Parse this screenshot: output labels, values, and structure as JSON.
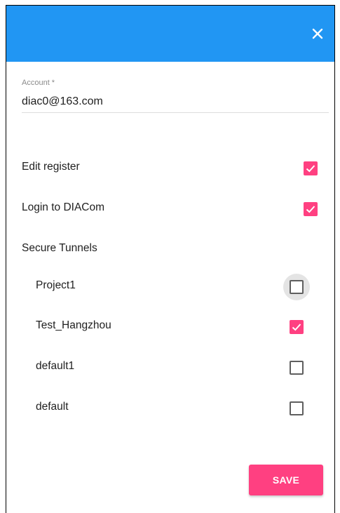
{
  "dialog": {
    "header_color": "#2196f3",
    "close_icon": "close-icon"
  },
  "account": {
    "label": "Account *",
    "value": "diac0@163.com"
  },
  "permissions": [
    {
      "label": "Edit register",
      "checked": true
    },
    {
      "label": "Login to DIACom",
      "checked": true
    }
  ],
  "secure_tunnels": {
    "heading": "Secure Tunnels",
    "items": [
      {
        "label": "Project1",
        "checked": false,
        "focused": true
      },
      {
        "label": "Test_Hangzhou",
        "checked": true,
        "focused": false
      },
      {
        "label": "default1",
        "checked": false,
        "focused": false
      },
      {
        "label": "default",
        "checked": false,
        "focused": false
      }
    ]
  },
  "save_label": "SAVE",
  "colors": {
    "accent": "#ff4081",
    "header": "#2196f3"
  }
}
